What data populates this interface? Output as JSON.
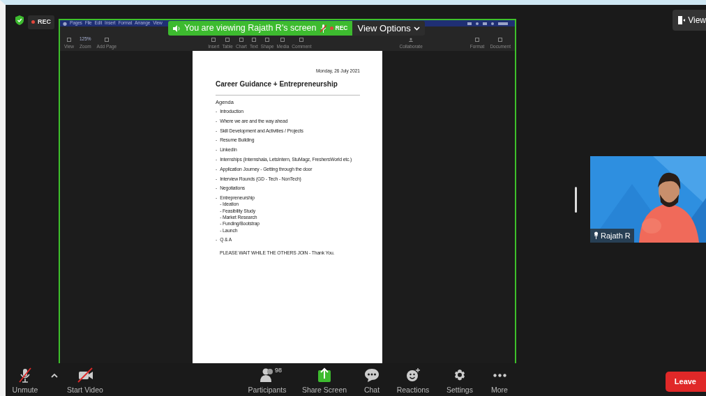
{
  "top_bar": {
    "rec_label": "REC",
    "view_button": "View"
  },
  "banner": {
    "text": "You are viewing Rajath R's screen",
    "rec_label": "REC",
    "view_options": "View Options"
  },
  "shared_screen": {
    "menu_items": [
      "Pages",
      "File",
      "Edit",
      "Insert",
      "Format",
      "Arrange",
      "View"
    ],
    "zoom_value": "125%",
    "toolbar_left": [
      "View",
      "Zoom",
      "Add Page"
    ],
    "toolbar_center": [
      "Insert",
      "Table",
      "Chart",
      "Text",
      "Shape",
      "Media",
      "Comment"
    ],
    "collaborate": "Collaborate",
    "toolbar_right": [
      "Format",
      "Document"
    ],
    "document": {
      "date": "Monday, 26 July 2021",
      "title": "Career Guidance + Entrepreneurship",
      "heading": "Agenda",
      "items": [
        {
          "marker": "-",
          "text": "Introduction"
        },
        {
          "marker": "-",
          "text": "Where we are and the way ahead"
        },
        {
          "marker": "-",
          "text": "Skill Development and Activities / Projects"
        },
        {
          "marker": "-",
          "text": "Resume Building"
        },
        {
          "marker": "-",
          "text": "LinkedIn"
        },
        {
          "marker": "-",
          "text": "Internships (Internshala, LetsIntern, StuMagz, FreshersWorld etc.)"
        },
        {
          "marker": "-",
          "text": "Application Journey - Getting through the door"
        },
        {
          "marker": "-",
          "text": "Interview Rounds (GD - Tech - NonTech)"
        },
        {
          "marker": "-",
          "text": "Negotiations"
        },
        {
          "marker": "-",
          "text": "Entrepreneurship",
          "children": [
            "- Ideation",
            "- Feasibility Study",
            "- Market Research",
            "- Funding/Bootstrap",
            "- Launch"
          ]
        },
        {
          "marker": "-",
          "text": "Q & A"
        }
      ],
      "note": "PLEASE WAIT WHILE THE OTHERS JOIN - Thank You."
    }
  },
  "video_tile": {
    "kind": "picture",
    "name": "Rajath R"
  },
  "toolbar": [
    {
      "kind": "mic",
      "label": "Unmute",
      "off": true
    },
    {
      "kind": "caret"
    },
    {
      "kind": "video",
      "label": "Start Video",
      "off": true
    },
    {
      "kind": "participants",
      "label": "Participants",
      "count": "98"
    },
    {
      "kind": "share",
      "label": "Share Screen"
    },
    {
      "kind": "chat",
      "label": "Chat"
    },
    {
      "kind": "reactions",
      "label": "Reactions"
    },
    {
      "kind": "settings",
      "label": "Settings"
    },
    {
      "kind": "more",
      "label": "More"
    },
    {
      "kind": "leave",
      "label": "Leave"
    }
  ]
}
